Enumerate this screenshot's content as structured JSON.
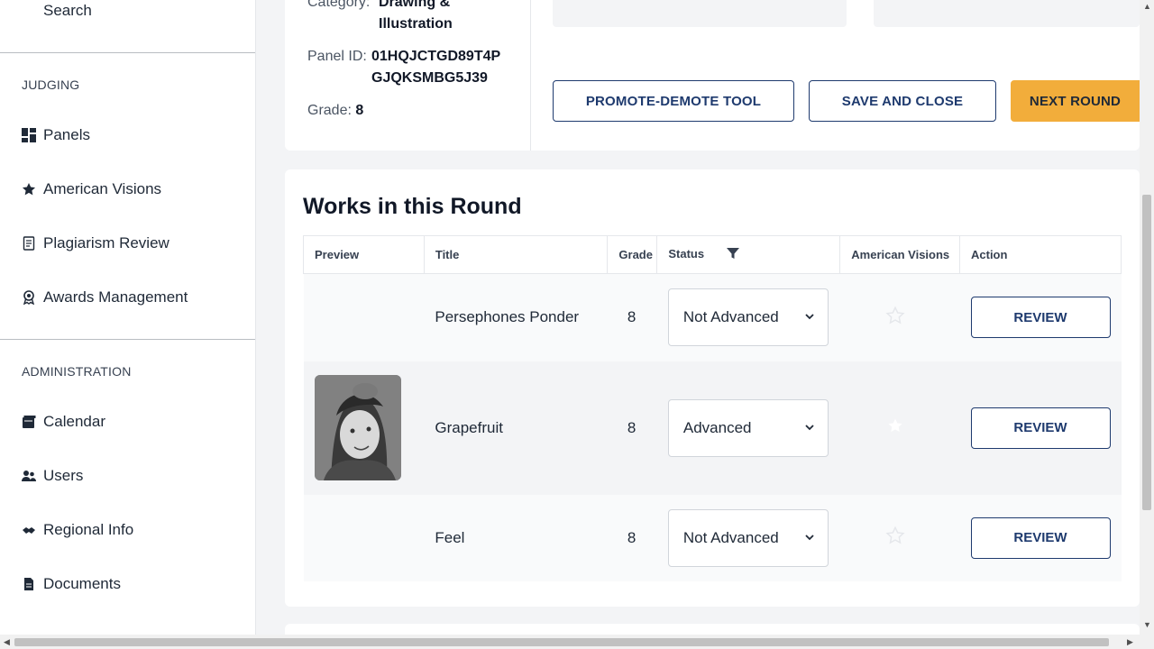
{
  "sidebar": {
    "search_label": "Search",
    "judging_heading": "JUDGING",
    "judging_items": [
      {
        "label": "Panels",
        "icon": "grid-icon"
      },
      {
        "label": "American Visions",
        "icon": "star-icon"
      },
      {
        "label": "Plagiarism Review",
        "icon": "document-icon"
      },
      {
        "label": "Awards Management",
        "icon": "award-icon"
      }
    ],
    "admin_heading": "ADMINISTRATION",
    "admin_items": [
      {
        "label": "Calendar",
        "icon": "calendar-icon"
      },
      {
        "label": "Users",
        "icon": "users-icon"
      },
      {
        "label": "Regional Info",
        "icon": "handshake-icon"
      },
      {
        "label": "Documents",
        "icon": "file-icon"
      }
    ]
  },
  "panel": {
    "category_label": "Category:",
    "category_value_line1": "Drawing &",
    "category_value_line2": "Illustration",
    "panel_id_label": "Panel ID:",
    "panel_id_line1": "01HQJCTGD89T4P",
    "panel_id_line2": "GJQKSMBG5J39",
    "grade_label": "Grade:",
    "grade_value": "8"
  },
  "actions": {
    "promote_demote": "PROMOTE-DEMOTE TOOL",
    "save_close": "SAVE AND CLOSE",
    "next_round": "NEXT ROUND"
  },
  "works": {
    "title": "Works in this Round",
    "columns": [
      "Preview",
      "Title",
      "Grade",
      "Status",
      "American Visions",
      "Action"
    ],
    "rows": [
      {
        "title": "Persephones Ponder",
        "grade": "8",
        "status": "Not Advanced",
        "has_preview": false,
        "american_visions": false,
        "action": "REVIEW"
      },
      {
        "title": "Grapefruit",
        "grade": "8",
        "status": "Advanced",
        "has_preview": true,
        "american_visions": false,
        "action": "REVIEW"
      },
      {
        "title": "Feel",
        "grade": "8",
        "status": "Not Advanced",
        "has_preview": false,
        "american_visions": false,
        "action": "REVIEW"
      }
    ]
  },
  "colors": {
    "primary_navy": "#1e3a6e",
    "accent_orange": "#f2ad3b"
  }
}
